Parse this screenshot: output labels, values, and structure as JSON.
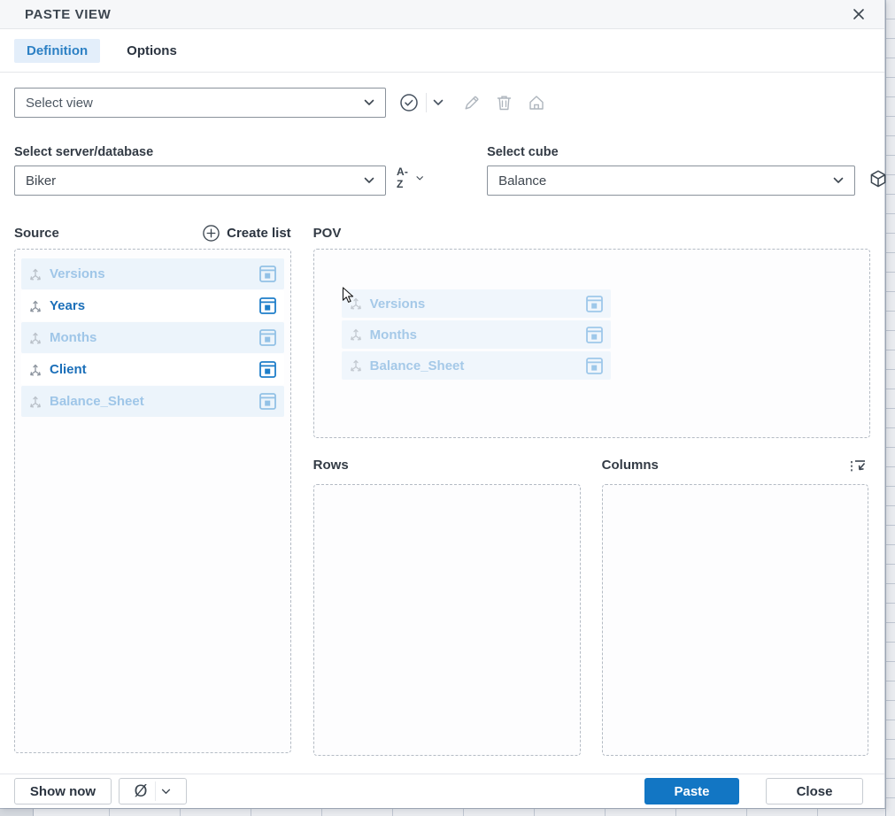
{
  "dialog": {
    "title": "PASTE VIEW"
  },
  "icons": {
    "close": "close-icon",
    "check_circle": "confirm-view-icon",
    "edit": "pencil-icon",
    "delete": "trash-icon",
    "home": "home-icon",
    "sort_glyph": "A-Z",
    "cube": "cube-icon",
    "create_list_plus": "plus-circle-icon",
    "dimension": "axis-icon",
    "subset": "subset-editor-icon",
    "transpose": "transpose-axes-icon",
    "suppress_zeros_glyph": "Ø"
  },
  "tabs": [
    {
      "label": "Definition",
      "active": true
    },
    {
      "label": "Options",
      "active": false
    }
  ],
  "view_selector": {
    "placeholder": "Select view"
  },
  "server": {
    "label": "Select server/database",
    "value": "Biker",
    "sort_label": "A-Z"
  },
  "cube": {
    "label": "Select cube",
    "value": "Balance"
  },
  "source": {
    "label": "Source",
    "create_list_label": "Create list",
    "items": [
      {
        "label": "Versions",
        "state": "faded"
      },
      {
        "label": "Years",
        "state": "active"
      },
      {
        "label": "Months",
        "state": "faded"
      },
      {
        "label": "Client",
        "state": "active"
      },
      {
        "label": "Balance_Sheet",
        "state": "faded"
      }
    ]
  },
  "pov": {
    "label": "POV",
    "items": [
      {
        "label": "Versions"
      },
      {
        "label": "Months"
      },
      {
        "label": "Balance_Sheet"
      }
    ]
  },
  "rows_section": {
    "label": "Rows",
    "items": []
  },
  "columns_section": {
    "label": "Columns",
    "items": []
  },
  "footer": {
    "show_now_label": "Show now",
    "suppress_zeros_glyph": "Ø",
    "paste_label": "Paste",
    "close_label": "Close"
  },
  "colors": {
    "accent_blue": "#1276c4",
    "active_tab_bg": "#e3eefa",
    "active_tab_text": "#2c80c4",
    "active_item_text": "#1b6fb9",
    "faded_item_text": "#9fc6e8",
    "faded_row_bg": "#ecf4fb",
    "pov_row_bg": "#f0f6fc",
    "dashed_border": "#b4bbc4",
    "titlebar_bg": "#f6f7f9",
    "spreadsheet_bg": "#e9ebef"
  }
}
